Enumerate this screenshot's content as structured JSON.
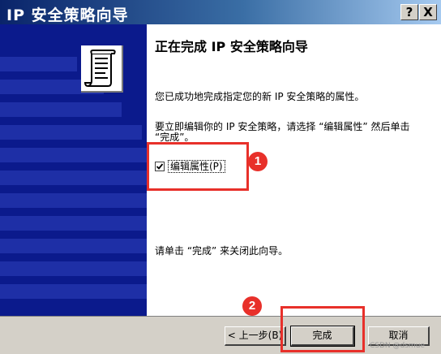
{
  "window": {
    "title": "IP 安全策略向导",
    "help_label": "?",
    "close_label": "X"
  },
  "main": {
    "heading": "正在完成 IP 安全策略向导",
    "description": "您已成功地完成指定您的新 IP 安全策略的属性。",
    "edit_note": "要立即编辑你的 IP 安全策略，请选择 “编辑属性” 然后单击 “完成”。",
    "checkbox_label": "编辑属性(P)",
    "checkbox_checked": true,
    "finish_note": "请单击 “完成” 来关闭此向导。"
  },
  "buttons": {
    "back": "< 上一步(B)",
    "finish": "完成",
    "cancel": "取消"
  },
  "annotations": {
    "step1": "1",
    "step2": "2"
  },
  "watermark": "CSDN @dsmue"
}
